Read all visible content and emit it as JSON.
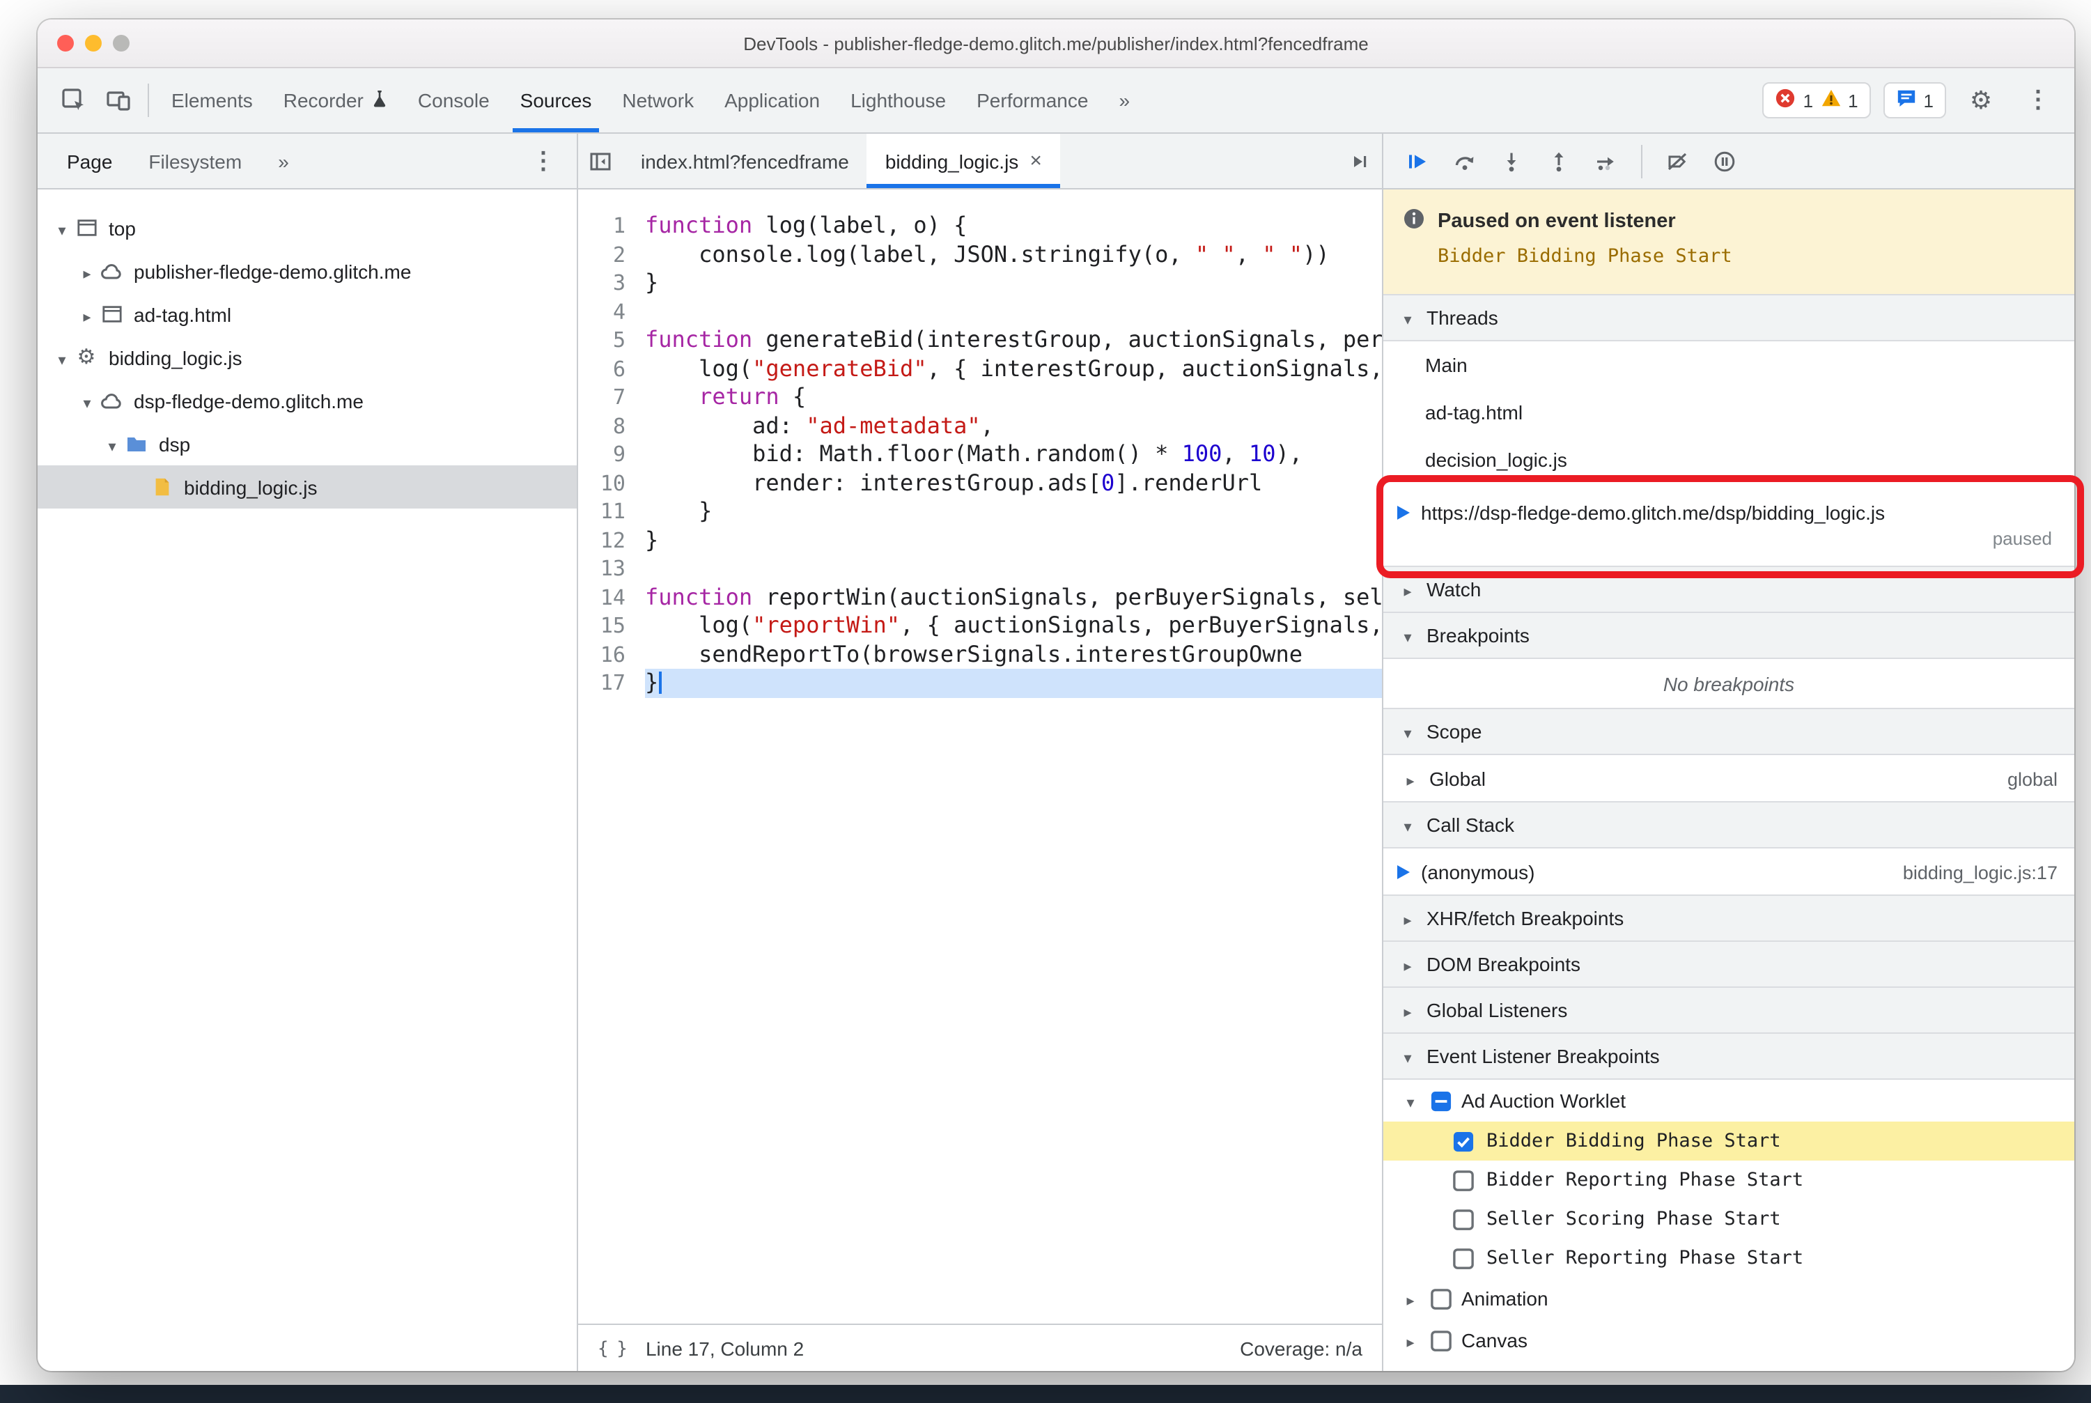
{
  "window": {
    "title": "DevTools - publisher-fledge-demo.glitch.me/publisher/index.html?fencedframe"
  },
  "main_tabs": {
    "items": [
      {
        "name": "tab-elements",
        "label": "Elements"
      },
      {
        "name": "tab-recorder",
        "label": "Recorder",
        "icon": "experiment-icon"
      },
      {
        "name": "tab-console",
        "label": "Console"
      },
      {
        "name": "tab-sources",
        "label": "Sources",
        "selected": true
      },
      {
        "name": "tab-network",
        "label": "Network"
      },
      {
        "name": "tab-application",
        "label": "Application"
      },
      {
        "name": "tab-lighthouse",
        "label": "Lighthouse"
      },
      {
        "name": "tab-performance",
        "label": "Performance"
      },
      {
        "name": "tab-more",
        "label": "»"
      }
    ],
    "error_count": "1",
    "warning_count": "1",
    "issues_count": "1"
  },
  "navigator": {
    "tabs": [
      {
        "name": "navigator-tab-page",
        "label": "Page",
        "selected": true
      },
      {
        "name": "navigator-tab-filesystem",
        "label": "Filesystem"
      },
      {
        "name": "navigator-tab-more",
        "label": "»"
      }
    ],
    "tree": [
      {
        "depth": 0,
        "expand": "open",
        "icon": "frame-icon",
        "label": "top"
      },
      {
        "depth": 1,
        "expand": "closed",
        "icon": "cloud-icon",
        "label": "publisher-fledge-demo.glitch.me"
      },
      {
        "depth": 1,
        "expand": "closed",
        "icon": "frame-icon",
        "label": "ad-tag.html"
      },
      {
        "depth": 0,
        "expand": "open",
        "icon": "gear-icon",
        "label": "bidding_logic.js"
      },
      {
        "depth": 1,
        "expand": "open",
        "icon": "cloud-icon",
        "label": "dsp-fledge-demo.glitch.me"
      },
      {
        "depth": 2,
        "expand": "open",
        "icon": "folder-icon",
        "label": "dsp"
      },
      {
        "depth": 3,
        "expand": "none",
        "icon": "file-icon",
        "label": "bidding_logic.js",
        "selected": true
      }
    ]
  },
  "editor": {
    "tabs": [
      {
        "name": "editor-tab-index-html",
        "label": "index.html?fencedframe"
      },
      {
        "name": "editor-tab-bidding-logic",
        "label": "bidding_logic.js",
        "active": true,
        "closable": true
      }
    ],
    "current_line": 17,
    "code_lines": [
      {
        "n": 1,
        "t": [
          [
            "kw",
            "function"
          ],
          [
            "pl",
            " log(label, o) {"
          ]
        ]
      },
      {
        "n": 2,
        "t": [
          [
            "pl",
            "    console.log(label, JSON.stringify(o, "
          ],
          [
            "str",
            "\" \""
          ],
          [
            "pl",
            ", "
          ],
          [
            "str",
            "\" \""
          ],
          [
            "pl",
            "))"
          ]
        ]
      },
      {
        "n": 3,
        "t": [
          [
            "pl",
            "}"
          ]
        ]
      },
      {
        "n": 4,
        "t": []
      },
      {
        "n": 5,
        "t": [
          [
            "kw",
            "function"
          ],
          [
            "pl",
            " generateBid(interestGroup, auctionSignals, perBuyerSignals, trustedBiddingSignals, browserSignals) {"
          ]
        ]
      },
      {
        "n": 6,
        "t": [
          [
            "pl",
            "    log("
          ],
          [
            "str",
            "\"generateBid\""
          ],
          [
            "pl",
            ", { interestGroup, auctionSignals, perBuyerSignals, trustedBiddingSignals });"
          ]
        ]
      },
      {
        "n": 7,
        "t": [
          [
            "pl",
            "    "
          ],
          [
            "kw",
            "return"
          ],
          [
            "pl",
            " {"
          ]
        ]
      },
      {
        "n": 8,
        "t": [
          [
            "pl",
            "        ad: "
          ],
          [
            "str",
            "\"ad-metadata\""
          ],
          [
            "pl",
            ","
          ]
        ]
      },
      {
        "n": 9,
        "t": [
          [
            "pl",
            "        bid: Math.floor(Math.random() * "
          ],
          [
            "num",
            "100"
          ],
          [
            "pl",
            ", "
          ],
          [
            "num",
            "10"
          ],
          [
            "pl",
            "),"
          ]
        ]
      },
      {
        "n": 10,
        "t": [
          [
            "pl",
            "        render: interestGroup.ads["
          ],
          [
            "num",
            "0"
          ],
          [
            "pl",
            "].renderUrl"
          ]
        ]
      },
      {
        "n": 11,
        "t": [
          [
            "pl",
            "    }"
          ]
        ]
      },
      {
        "n": 12,
        "t": [
          [
            "pl",
            "}"
          ]
        ]
      },
      {
        "n": 13,
        "t": []
      },
      {
        "n": 14,
        "t": [
          [
            "kw",
            "function"
          ],
          [
            "pl",
            " reportWin(auctionSignals, perBuyerSignals, sellerSignals, browserSignals) {"
          ]
        ]
      },
      {
        "n": 15,
        "t": [
          [
            "pl",
            "    log("
          ],
          [
            "str",
            "\"reportWin\""
          ],
          [
            "pl",
            ", { auctionSignals, perBuyerSignals, sellerSignals });"
          ]
        ]
      },
      {
        "n": 16,
        "t": [
          [
            "pl",
            "    sendReportTo(browserSignals.interestGroupOwne"
          ]
        ]
      },
      {
        "n": 17,
        "t": [
          [
            "pl",
            "}"
          ]
        ]
      }
    ],
    "status": {
      "position": "Line 17, Column 2",
      "coverage": "Coverage: n/a"
    }
  },
  "debugger": {
    "banner": {
      "title": "Paused on event listener",
      "detail": "Bidder Bidding Phase Start"
    },
    "threads": {
      "label": "Threads",
      "items": [
        {
          "label": "Main"
        },
        {
          "label": "ad-tag.html"
        },
        {
          "label": "decision_logic.js"
        },
        {
          "label": "https://dsp-fledge-demo.glitch.me/dsp/bidding_logic.js",
          "status": "paused",
          "current": true
        }
      ]
    },
    "watch": {
      "label": "Watch"
    },
    "breakpoints": {
      "label": "Breakpoints",
      "empty": "No breakpoints"
    },
    "scope": {
      "label": "Scope",
      "rows": [
        {
          "label": "Global",
          "value": "global"
        }
      ]
    },
    "call_stack": {
      "label": "Call Stack",
      "rows": [
        {
          "label": "(anonymous)",
          "location": "bidding_logic.js:17",
          "current": true
        }
      ]
    },
    "xhr": {
      "label": "XHR/fetch Breakpoints"
    },
    "dom": {
      "label": "DOM Breakpoints"
    },
    "global_listeners": {
      "label": "Global Listeners"
    },
    "event_listener_breakpoints": {
      "label": "Event Listener Breakpoints",
      "groups": [
        {
          "label": "Ad Auction Worklet",
          "expand": "open",
          "checkbox": "indeterminate",
          "children": [
            {
              "label": "Bidder Bidding Phase Start",
              "checked": true,
              "highlighted": true
            },
            {
              "label": "Bidder Reporting Phase Start",
              "checked": false
            },
            {
              "label": "Seller Scoring Phase Start",
              "checked": false
            },
            {
              "label": "Seller Reporting Phase Start",
              "checked": false
            }
          ]
        },
        {
          "label": "Animation",
          "expand": "closed",
          "checkbox": "unchecked",
          "children": []
        },
        {
          "label": "Canvas",
          "expand": "closed",
          "checkbox": "unchecked",
          "children": []
        }
      ]
    }
  },
  "colors": {
    "accent_blue": "#1a73e8",
    "annotation_red": "#eb1c24",
    "paused_banner_bg": "#fcf3d4",
    "event_highlight_yellow": "#fcf0a3",
    "active_line_blue": "#cfe3fc",
    "selected_tree_gray": "#d8dadd",
    "error_red": "#df3a2f",
    "warning_yellow": "#f2a600"
  }
}
